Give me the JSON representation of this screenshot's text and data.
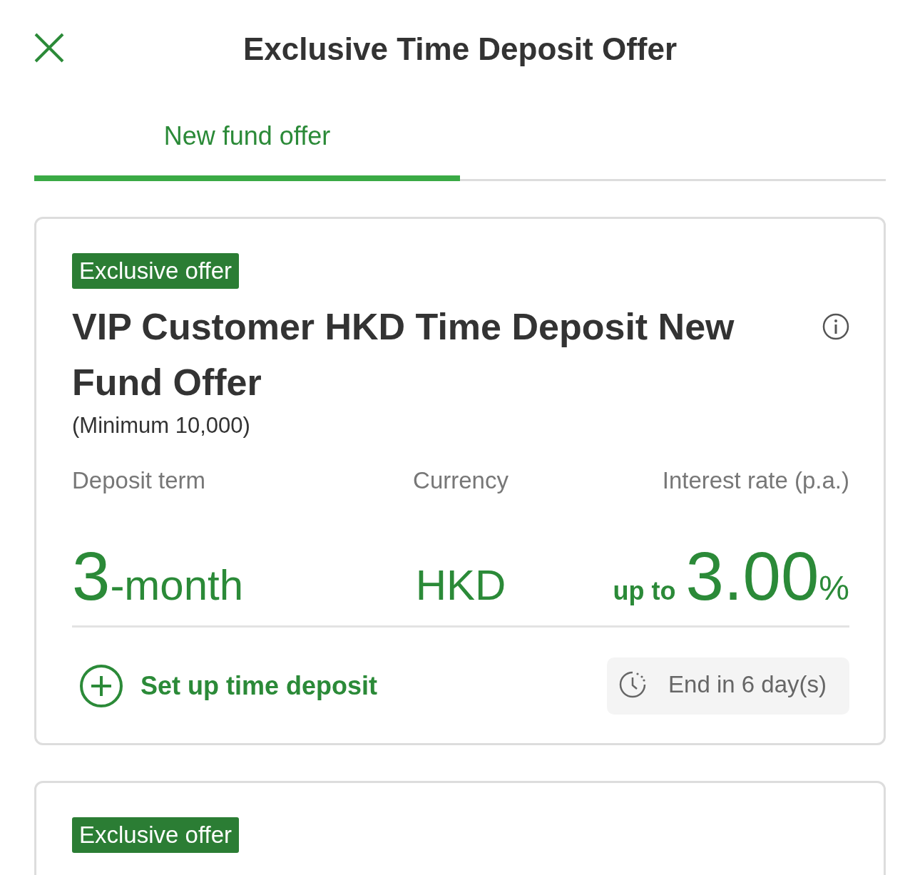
{
  "header": {
    "title": "Exclusive Time Deposit Offer"
  },
  "tabs": [
    {
      "label": "New fund offer",
      "selected": true
    }
  ],
  "offers": [
    {
      "badge": "Exclusive offer",
      "title": "VIP Customer HKD Time Deposit New Fund Offer",
      "minimum": "(Minimum 10,000)",
      "labels": [
        "Deposit term",
        "Currency",
        "Interest rate (p.a.)"
      ],
      "term_number": "3",
      "term_unit": "-month",
      "currency": "HKD",
      "rate_prefix": "up to",
      "rate": "3.00",
      "rate_unit": "%",
      "action": "Set up time deposit",
      "countdown": "End in 6 day(s)"
    },
    {
      "badge": "Exclusive offer"
    }
  ]
}
